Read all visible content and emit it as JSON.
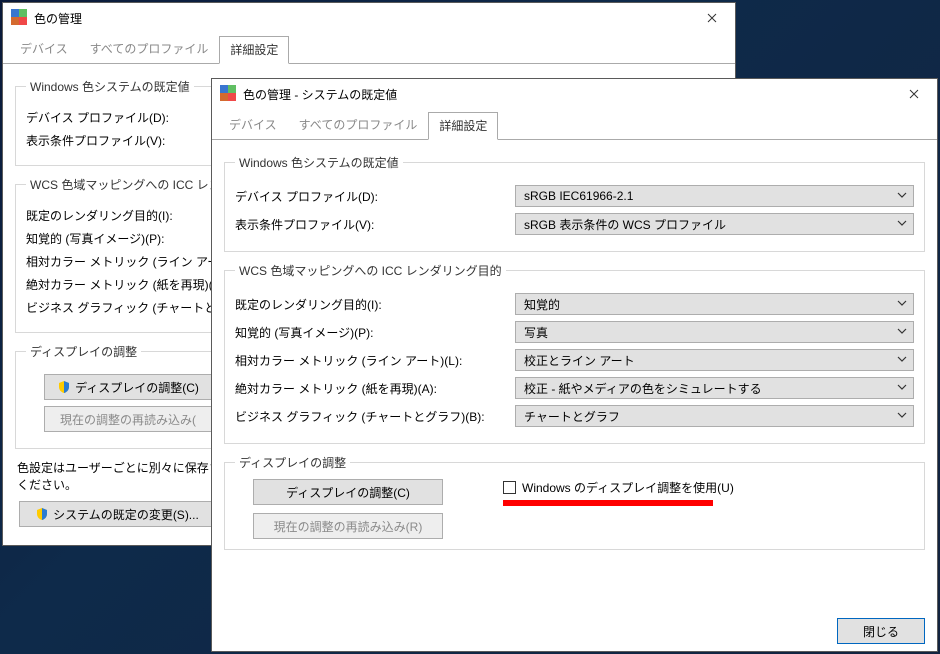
{
  "back": {
    "title": "色の管理",
    "tabs": [
      "デバイス",
      "すべてのプロファイル",
      "詳細設定"
    ],
    "group_defaults": {
      "legend": "Windows 色システムの既定値",
      "device_profile_label": "デバイス プロファイル(D):",
      "viewing_cond_label": "表示条件プロファイル(V):"
    },
    "group_wcs": {
      "legend": "WCS 色域マッピングへの ICC レンダリ",
      "default_rendering_label": "既定のレンダリング目的(I):",
      "perceptual_label": "知覚的 (写真イメージ)(P):",
      "relcol_label": "相対カラー メトリック (ライン アート)(L):",
      "abscol_label": "絶対カラー メトリック (紙を再現)(A):",
      "bizgfx_label": "ビジネス グラフィック (チャートとグラフ)(B):"
    },
    "group_display": {
      "legend": "ディスプレイの調整",
      "calibrate_btn": "ディスプレイの調整(C)",
      "reload_btn": "現在の調整の再読み込み("
    },
    "peruser_text1": "色設定はユーザーごとに別々に保存され",
    "peruser_text2": "ください。",
    "sysdefault_btn": "システムの既定の変更(S)..."
  },
  "front": {
    "title": "色の管理 - システムの既定値",
    "tabs": [
      "デバイス",
      "すべてのプロファイル",
      "詳細設定"
    ],
    "group_defaults": {
      "legend": "Windows 色システムの既定値",
      "device_profile_label": "デバイス プロファイル(D):",
      "device_profile_value": "sRGB IEC61966-2.1",
      "viewing_cond_label": "表示条件プロファイル(V):",
      "viewing_cond_value": "sRGB 表示条件の WCS プロファイル"
    },
    "group_wcs": {
      "legend": "WCS 色域マッピングへの ICC レンダリング目的",
      "default_rendering_label": "既定のレンダリング目的(I):",
      "default_rendering_value": "知覚的",
      "perceptual_label": "知覚的 (写真イメージ)(P):",
      "perceptual_value": "写真",
      "relcol_label": "相対カラー メトリック (ライン アート)(L):",
      "relcol_value": "校正とライン アート",
      "abscol_label": "絶対カラー メトリック (紙を再現)(A):",
      "abscol_value": "校正 - 紙やメディアの色をシミュレートする",
      "bizgfx_label": "ビジネス グラフィック (チャートとグラフ)(B):",
      "bizgfx_value": "チャートとグラフ"
    },
    "group_display": {
      "legend": "ディスプレイの調整",
      "calibrate_btn": "ディスプレイの調整(C)",
      "reload_btn": "現在の調整の再読み込み(R)",
      "use_windows_label": "Windows のディスプレイ調整を使用(U)"
    },
    "close_btn": "閉じる"
  }
}
